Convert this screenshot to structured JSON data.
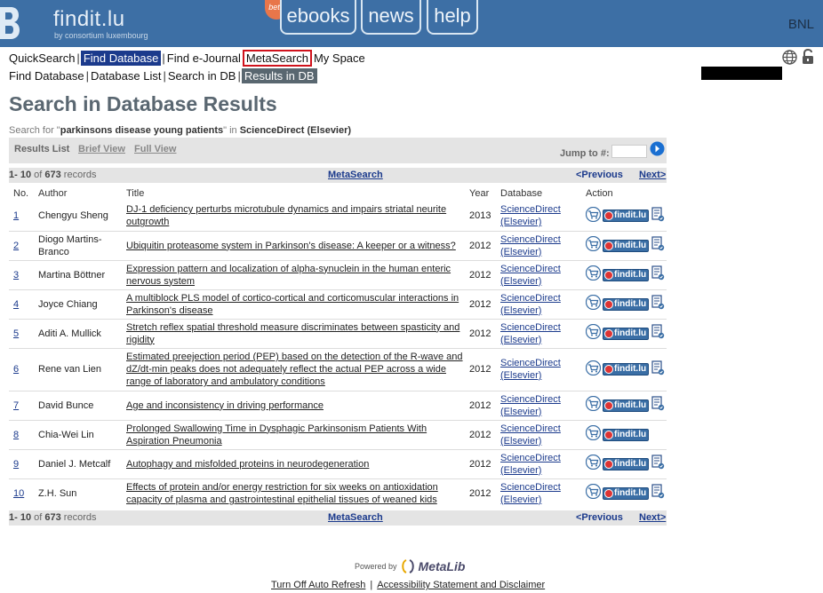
{
  "banner": {
    "logo_text": "findit.lu",
    "logo_sub": "by consortium luxembourg",
    "beta": "beta",
    "tabs": [
      "ebooks",
      "news",
      "help"
    ],
    "user_code": "BNL",
    "color": "#3d6fa5"
  },
  "nav": {
    "row1": [
      "QuickSearch",
      "Find Database",
      "Find e-Journal",
      "MetaSearch",
      "My Space"
    ],
    "row2": [
      "Find Database",
      "Database List",
      "Search in DB",
      "Results in DB"
    ]
  },
  "page": {
    "title": "Search in Database Results",
    "search_prefix": "Search for \"",
    "search_query": "parkinsons disease young patients",
    "search_mid": "\" in ",
    "search_db": "ScienceDirect (Elsevier)"
  },
  "viewbar": {
    "label": "Results List",
    "brief": "Brief View",
    "full": "Full View",
    "jump_label": "Jump to #:",
    "jump_value": ""
  },
  "pager": {
    "range": "1- 10",
    "of": " of ",
    "total": "673",
    "records": " records",
    "metasearch": "MetaSearch",
    "prev": "<Previous",
    "next": "Next>"
  },
  "table": {
    "headers": [
      "No.",
      "Author",
      "Title",
      "Year",
      "Database",
      "Action"
    ],
    "rows": [
      {
        "no": "1",
        "author": "Chengyu Sheng",
        "title": "DJ-1 deficiency perturbs microtubule dynamics and impairs striatal neurite outgrowth",
        "year": "2013",
        "db": "ScienceDirect (Elsevier)",
        "has_doc": true
      },
      {
        "no": "2",
        "author": "Diogo Martins-Branco",
        "title": "Ubiquitin proteasome system in Parkinson's disease: A keeper or a witness?",
        "year": "2012",
        "db": "ScienceDirect (Elsevier)",
        "has_doc": true
      },
      {
        "no": "3",
        "author": "Martina Böttner",
        "title": "Expression pattern and localization of alpha-synuclein in the human enteric nervous system",
        "year": "2012",
        "db": "ScienceDirect (Elsevier)",
        "has_doc": true
      },
      {
        "no": "4",
        "author": "Joyce Chiang",
        "title": "A multiblock PLS model of cortico-cortical and corticomuscular interactions in Parkinson's disease",
        "year": "2012",
        "db": "ScienceDirect (Elsevier)",
        "has_doc": true
      },
      {
        "no": "5",
        "author": "Aditi A. Mullick",
        "title": "Stretch reflex spatial threshold measure discriminates between spasticity and rigidity",
        "year": "2012",
        "db": "ScienceDirect (Elsevier)",
        "has_doc": true
      },
      {
        "no": "6",
        "author": "Rene van Lien",
        "title": "Estimated preejection period (PEP) based on the detection of the R-wave and dZ/dt-min peaks does not adequately reflect the actual PEP across a wide range of laboratory and ambulatory conditions",
        "year": "2012",
        "db": "ScienceDirect (Elsevier)",
        "has_doc": true
      },
      {
        "no": "7",
        "author": "David Bunce",
        "title": "Age and inconsistency in driving performance",
        "year": "2012",
        "db": "ScienceDirect (Elsevier)",
        "has_doc": true
      },
      {
        "no": "8",
        "author": "Chia-Wei Lin",
        "title": "Prolonged Swallowing Time in Dysphagic Parkinsonism Patients With Aspiration Pneumonia",
        "year": "2012",
        "db": "ScienceDirect (Elsevier)",
        "has_doc": false
      },
      {
        "no": "9",
        "author": "Daniel J. Metcalf",
        "title": "Autophagy and misfolded proteins in neurodegeneration",
        "year": "2012",
        "db": "ScienceDirect (Elsevier)",
        "has_doc": true
      },
      {
        "no": "10",
        "author": "Z.H. Sun",
        "title": "Effects of protein and/or energy restriction for six weeks on antioxidation capacity of plasma and gastrointestinal epithelial tissues of weaned kids",
        "year": "2012",
        "db": "ScienceDirect (Elsevier)",
        "has_doc": true
      }
    ],
    "findit_label": "findit.lu"
  },
  "footer": {
    "powered_by": "Powered by",
    "metalib": "MetaLib",
    "link1": "Turn Off Auto Refresh",
    "link2": "Accessibility Statement and Disclaimer"
  }
}
